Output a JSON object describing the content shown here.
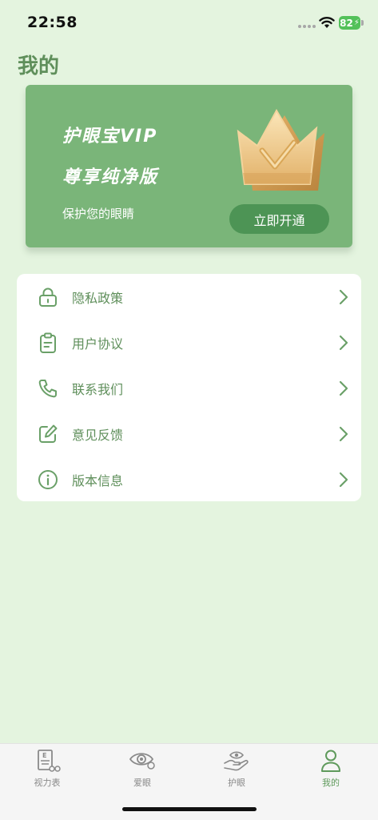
{
  "status_bar": {
    "time": "22:58",
    "battery": "82"
  },
  "header": {
    "title": "我的"
  },
  "vip_card": {
    "title": "护眼宝VIP",
    "subtitle": "尊享纯净版",
    "description": "保护您的眼睛",
    "button_label": "立即开通",
    "icon": "crown-icon"
  },
  "menu": {
    "items": [
      {
        "label": "隐私政策",
        "icon": "lock-icon"
      },
      {
        "label": "用户协议",
        "icon": "clipboard-icon"
      },
      {
        "label": "联系我们",
        "icon": "phone-icon"
      },
      {
        "label": "意见反馈",
        "icon": "edit-icon"
      },
      {
        "label": "版本信息",
        "icon": "info-icon"
      }
    ]
  },
  "tab_bar": {
    "tabs": [
      {
        "label": "视力表",
        "icon": "eye-chart-icon",
        "active": false
      },
      {
        "label": "爱眼",
        "icon": "eye-icon",
        "active": false
      },
      {
        "label": "护眼",
        "icon": "hand-eye-icon",
        "active": false
      },
      {
        "label": "我的",
        "icon": "user-icon",
        "active": true
      }
    ]
  },
  "colors": {
    "background": "#e4f4df",
    "accent": "#7ab579",
    "accent_dark": "#4d9455",
    "text_green": "#5f8f5b",
    "card": "#ffffff"
  }
}
